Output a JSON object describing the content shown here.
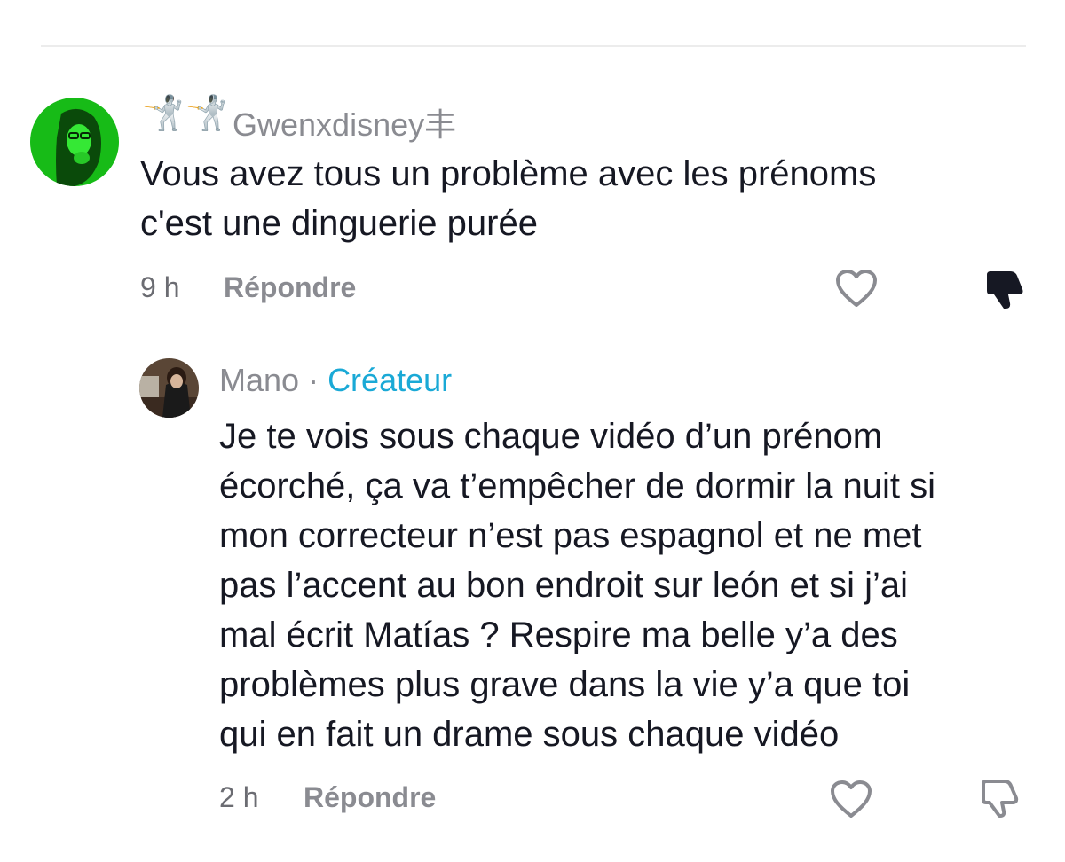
{
  "comments": [
    {
      "username": "Gwenxdisney丰",
      "badge_icons": "🤺🤺",
      "text_lines": [
        "Vous avez tous un problème avec les prénoms",
        "c'est une dinguerie purée"
      ],
      "time": "9 h",
      "reply_label": "Répondre",
      "liked": false,
      "disliked": true
    }
  ],
  "replies": [
    {
      "username": "Mano",
      "separator": " · ",
      "creator_label": "Créateur",
      "text_lines": [
        "Je te vois sous chaque vidéo d’un prénom",
        "écorché, ça va t’empêcher de dormir la nuit si",
        "mon correcteur n’est pas espagnol et ne met",
        "pas l’accent au bon endroit sur león et si j’ai",
        "mal écrit Matías ? Respire ma belle y’a des",
        "problèmes plus grave dans la vie y’a que toi",
        "qui en fait un drame sous chaque vidéo"
      ],
      "time": "2 h",
      "reply_label": "Répondre",
      "liked": false,
      "disliked": false
    }
  ],
  "colors": {
    "creator_accent": "#1aa9d6",
    "meta_gray": "#8a8b91",
    "text": "#161823"
  }
}
